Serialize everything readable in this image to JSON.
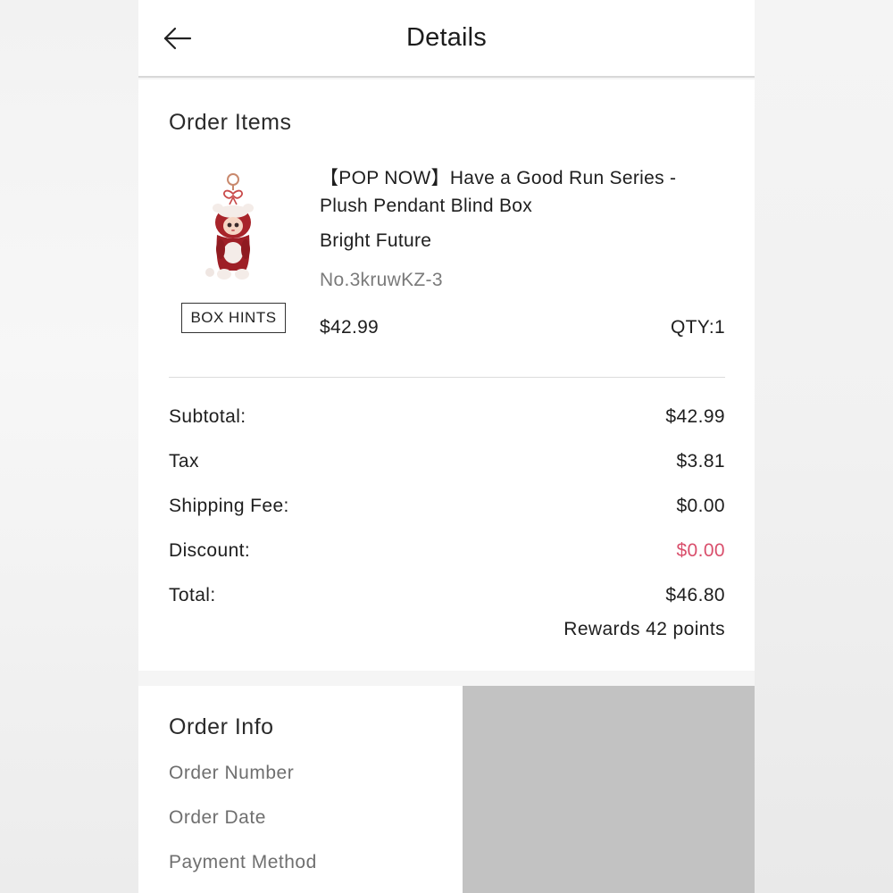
{
  "header": {
    "title": "Details",
    "back_icon": "arrow-left-icon"
  },
  "order_items": {
    "section_title": "Order Items",
    "items": [
      {
        "name": "【POP NOW】Have a Good Run Series - Plush Pendant Blind Box",
        "variant": "Bright Future",
        "number": "No.3kruwKZ-3",
        "price": "$42.99",
        "qty": "QTY:1",
        "box_hints_label": "BOX HINTS",
        "image": "plush-pendant-doll-red-hood"
      }
    ]
  },
  "summary": {
    "subtotal_label": "Subtotal:",
    "subtotal_value": "$42.99",
    "tax_label": "Tax",
    "tax_value": "$3.81",
    "shipping_label": "Shipping Fee:",
    "shipping_value": "$0.00",
    "discount_label": "Discount:",
    "discount_value": "$0.00",
    "total_label": "Total:",
    "total_value": "$46.80",
    "rewards": "Rewards 42 points"
  },
  "order_info": {
    "section_title": "Order Info",
    "labels": [
      "Order Number",
      "Order Date",
      "Payment Method"
    ]
  },
  "colors": {
    "discount": "#d94f6c",
    "text": "#1e1e1e",
    "muted": "#7a7a7a",
    "redacted_block": "#c2c2c2"
  }
}
